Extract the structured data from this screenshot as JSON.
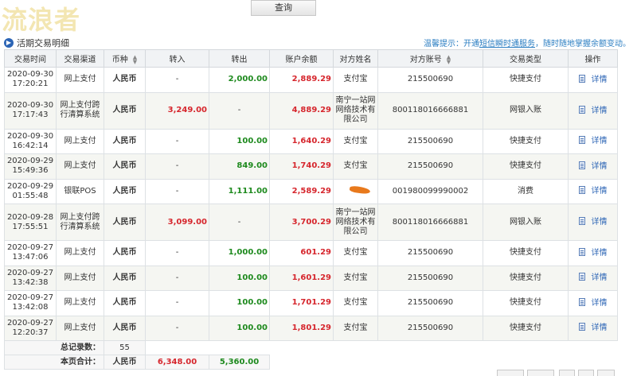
{
  "watermark": "流浪者",
  "query_button": "查询",
  "section": {
    "title": "活期交易明细",
    "tip_prefix": "温馨提示：开通",
    "tip_link": "短信瞬时通服务",
    "tip_suffix": "，随时随地掌握余额变动。"
  },
  "columns": [
    "交易时间",
    "交易渠道",
    "币种",
    "转入",
    "转出",
    "账户余额",
    "对方姓名",
    "对方账号",
    "交易类型",
    "操作"
  ],
  "rows": [
    {
      "date": "2020-09-30",
      "time": "17:20:21",
      "channel": "网上支付",
      "currency": "人民币",
      "in": "-",
      "out": "2,000.00",
      "balance": "2,889.29",
      "party": "支付宝",
      "account": "215500690",
      "type": "快捷支付",
      "op": "详情"
    },
    {
      "date": "2020-09-30",
      "time": "17:17:43",
      "channel": "网上支付跨行清算系统",
      "currency": "人民币",
      "in": "3,249.00",
      "out": "-",
      "balance": "4,889.29",
      "party": "南宁一站网网络技术有限公司",
      "account": "800118016666881",
      "type": "网银入账",
      "op": "详情"
    },
    {
      "date": "2020-09-30",
      "time": "16:42:14",
      "channel": "网上支付",
      "currency": "人民币",
      "in": "-",
      "out": "100.00",
      "balance": "1,640.29",
      "party": "支付宝",
      "account": "215500690",
      "type": "快捷支付",
      "op": "详情"
    },
    {
      "date": "2020-09-29",
      "time": "15:49:36",
      "channel": "网上支付",
      "currency": "人民币",
      "in": "-",
      "out": "849.00",
      "balance": "1,740.29",
      "party": "支付宝",
      "account": "215500690",
      "type": "快捷支付",
      "op": "详情"
    },
    {
      "date": "2020-09-29",
      "time": "01:55:48",
      "channel": "银联POS",
      "currency": "人民币",
      "in": "-",
      "out": "1,111.00",
      "balance": "2,589.29",
      "party": "",
      "account": "001980099990002",
      "type": "消费",
      "op": "详情"
    },
    {
      "date": "2020-09-28",
      "time": "17:55:51",
      "channel": "网上支付跨行清算系统",
      "currency": "人民币",
      "in": "3,099.00",
      "out": "-",
      "balance": "3,700.29",
      "party": "南宁一站网网络技术有限公司",
      "account": "800118016666881",
      "type": "网银入账",
      "op": "详情"
    },
    {
      "date": "2020-09-27",
      "time": "13:47:06",
      "channel": "网上支付",
      "currency": "人民币",
      "in": "-",
      "out": "1,000.00",
      "balance": "601.29",
      "party": "支付宝",
      "account": "215500690",
      "type": "快捷支付",
      "op": "详情"
    },
    {
      "date": "2020-09-27",
      "time": "13:42:38",
      "channel": "网上支付",
      "currency": "人民币",
      "in": "-",
      "out": "100.00",
      "balance": "1,601.29",
      "party": "支付宝",
      "account": "215500690",
      "type": "快捷支付",
      "op": "详情"
    },
    {
      "date": "2020-09-27",
      "time": "13:42:08",
      "channel": "网上支付",
      "currency": "人民币",
      "in": "-",
      "out": "100.00",
      "balance": "1,701.29",
      "party": "支付宝",
      "account": "215500690",
      "type": "快捷支付",
      "op": "详情"
    },
    {
      "date": "2020-09-27",
      "time": "12:20:37",
      "channel": "网上支付",
      "currency": "人民币",
      "in": "-",
      "out": "100.00",
      "balance": "1,801.29",
      "party": "支付宝",
      "account": "215500690",
      "type": "快捷支付",
      "op": "详情"
    }
  ],
  "footer": {
    "total_label": "总记录数：",
    "total_count": "55",
    "page_sum_label": "本页合计：",
    "page_sum_currency": "人民币",
    "page_sum_in": "6,348.00",
    "page_sum_out": "5,360.00"
  }
}
